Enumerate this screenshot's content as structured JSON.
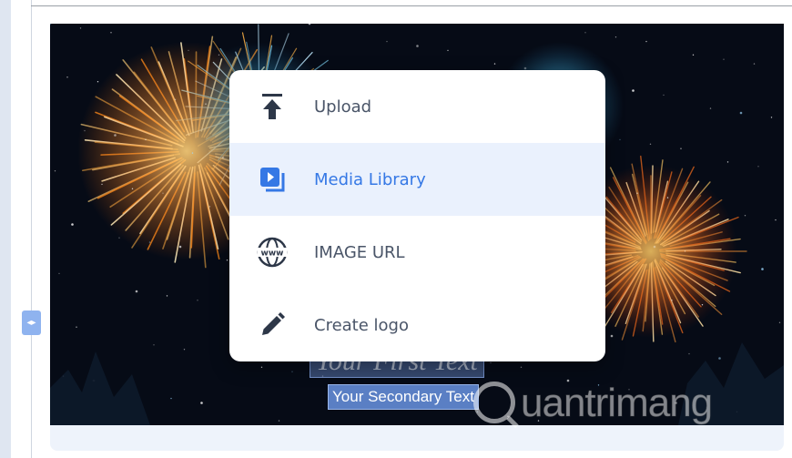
{
  "menu": {
    "items": [
      {
        "label": "Upload",
        "icon": "upload-icon",
        "active": false
      },
      {
        "label": "Media Library",
        "icon": "media-library-icon",
        "active": true
      },
      {
        "label": "IMAGE URL",
        "icon": "globe-www-icon",
        "active": false
      },
      {
        "label": "Create logo",
        "icon": "pencil-icon",
        "active": false
      }
    ]
  },
  "canvas": {
    "primary_text": "Your First Text",
    "secondary_text": "Your Secondary Text"
  },
  "watermark": {
    "text": "uantrimang"
  },
  "colors": {
    "accent": "#3578e5",
    "active_row_bg": "#eaf1fd",
    "canvas_bg": "#060b16",
    "handle": "#8fb3ef"
  }
}
